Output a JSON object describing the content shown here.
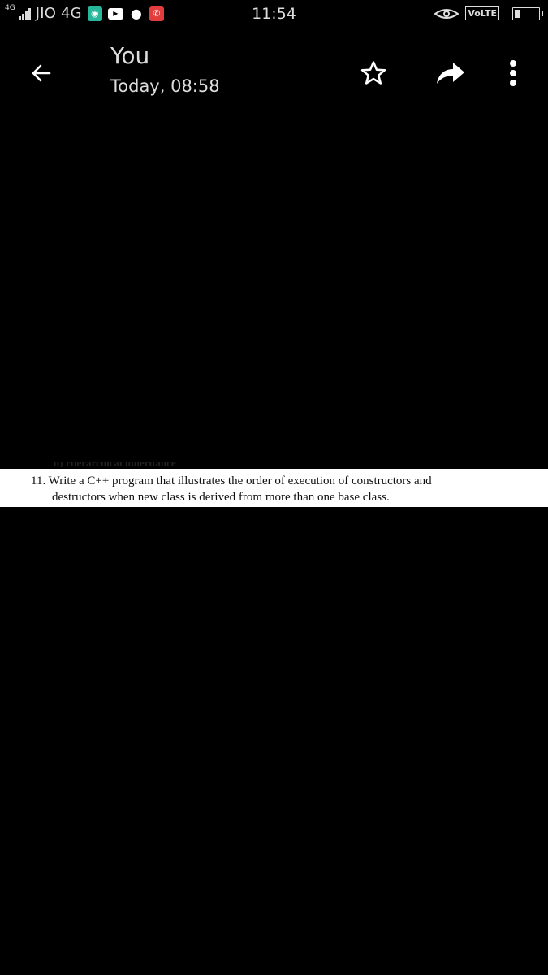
{
  "status_bar": {
    "network_badge": "4G",
    "carrier": "JIO 4G",
    "time": "11:54",
    "volte_label": "VoLTE",
    "battery_level_percent": 20,
    "notification_icons": [
      "app-notification-icon",
      "youtube-icon",
      "chat-bubble-icon",
      "missed-call-icon"
    ]
  },
  "header": {
    "title": "You",
    "subtitle": "Today, 08:58",
    "actions": [
      "back-arrow-icon",
      "star-icon",
      "share-forward-icon",
      "more-vert-icon"
    ]
  },
  "image": {
    "cut_heading": "d) Hierarchical inheritance",
    "line1": "11. Write a C++ program that illustrates the order of execution of constructors and",
    "line2": "destructors when new class is derived from more than one base class."
  }
}
